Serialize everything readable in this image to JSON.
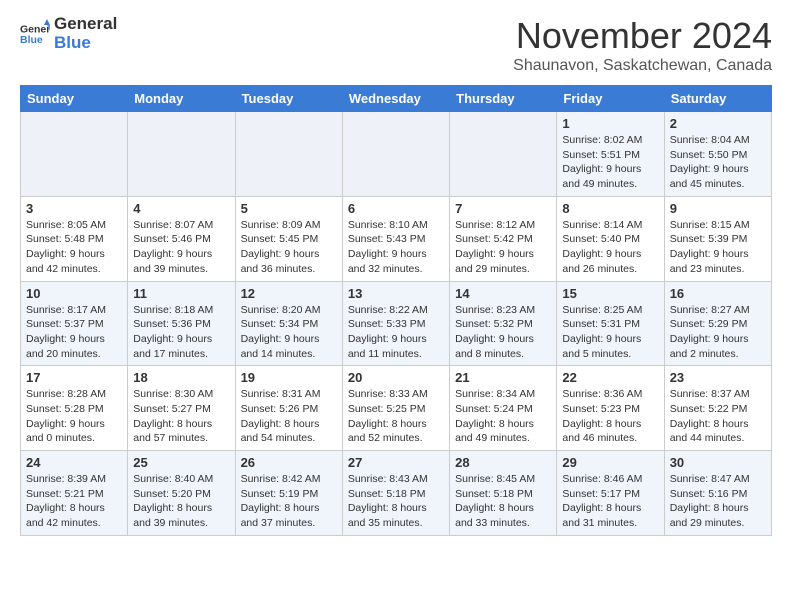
{
  "header": {
    "logo_line1": "General",
    "logo_line2": "Blue",
    "month_title": "November 2024",
    "location": "Shaunavon, Saskatchewan, Canada"
  },
  "weekdays": [
    "Sunday",
    "Monday",
    "Tuesday",
    "Wednesday",
    "Thursday",
    "Friday",
    "Saturday"
  ],
  "weeks": [
    [
      {
        "day": "",
        "info": ""
      },
      {
        "day": "",
        "info": ""
      },
      {
        "day": "",
        "info": ""
      },
      {
        "day": "",
        "info": ""
      },
      {
        "day": "",
        "info": ""
      },
      {
        "day": "1",
        "info": "Sunrise: 8:02 AM\nSunset: 5:51 PM\nDaylight: 9 hours and 49 minutes."
      },
      {
        "day": "2",
        "info": "Sunrise: 8:04 AM\nSunset: 5:50 PM\nDaylight: 9 hours and 45 minutes."
      }
    ],
    [
      {
        "day": "3",
        "info": "Sunrise: 8:05 AM\nSunset: 5:48 PM\nDaylight: 9 hours and 42 minutes."
      },
      {
        "day": "4",
        "info": "Sunrise: 8:07 AM\nSunset: 5:46 PM\nDaylight: 9 hours and 39 minutes."
      },
      {
        "day": "5",
        "info": "Sunrise: 8:09 AM\nSunset: 5:45 PM\nDaylight: 9 hours and 36 minutes."
      },
      {
        "day": "6",
        "info": "Sunrise: 8:10 AM\nSunset: 5:43 PM\nDaylight: 9 hours and 32 minutes."
      },
      {
        "day": "7",
        "info": "Sunrise: 8:12 AM\nSunset: 5:42 PM\nDaylight: 9 hours and 29 minutes."
      },
      {
        "day": "8",
        "info": "Sunrise: 8:14 AM\nSunset: 5:40 PM\nDaylight: 9 hours and 26 minutes."
      },
      {
        "day": "9",
        "info": "Sunrise: 8:15 AM\nSunset: 5:39 PM\nDaylight: 9 hours and 23 minutes."
      }
    ],
    [
      {
        "day": "10",
        "info": "Sunrise: 8:17 AM\nSunset: 5:37 PM\nDaylight: 9 hours and 20 minutes."
      },
      {
        "day": "11",
        "info": "Sunrise: 8:18 AM\nSunset: 5:36 PM\nDaylight: 9 hours and 17 minutes."
      },
      {
        "day": "12",
        "info": "Sunrise: 8:20 AM\nSunset: 5:34 PM\nDaylight: 9 hours and 14 minutes."
      },
      {
        "day": "13",
        "info": "Sunrise: 8:22 AM\nSunset: 5:33 PM\nDaylight: 9 hours and 11 minutes."
      },
      {
        "day": "14",
        "info": "Sunrise: 8:23 AM\nSunset: 5:32 PM\nDaylight: 9 hours and 8 minutes."
      },
      {
        "day": "15",
        "info": "Sunrise: 8:25 AM\nSunset: 5:31 PM\nDaylight: 9 hours and 5 minutes."
      },
      {
        "day": "16",
        "info": "Sunrise: 8:27 AM\nSunset: 5:29 PM\nDaylight: 9 hours and 2 minutes."
      }
    ],
    [
      {
        "day": "17",
        "info": "Sunrise: 8:28 AM\nSunset: 5:28 PM\nDaylight: 9 hours and 0 minutes."
      },
      {
        "day": "18",
        "info": "Sunrise: 8:30 AM\nSunset: 5:27 PM\nDaylight: 8 hours and 57 minutes."
      },
      {
        "day": "19",
        "info": "Sunrise: 8:31 AM\nSunset: 5:26 PM\nDaylight: 8 hours and 54 minutes."
      },
      {
        "day": "20",
        "info": "Sunrise: 8:33 AM\nSunset: 5:25 PM\nDaylight: 8 hours and 52 minutes."
      },
      {
        "day": "21",
        "info": "Sunrise: 8:34 AM\nSunset: 5:24 PM\nDaylight: 8 hours and 49 minutes."
      },
      {
        "day": "22",
        "info": "Sunrise: 8:36 AM\nSunset: 5:23 PM\nDaylight: 8 hours and 46 minutes."
      },
      {
        "day": "23",
        "info": "Sunrise: 8:37 AM\nSunset: 5:22 PM\nDaylight: 8 hours and 44 minutes."
      }
    ],
    [
      {
        "day": "24",
        "info": "Sunrise: 8:39 AM\nSunset: 5:21 PM\nDaylight: 8 hours and 42 minutes."
      },
      {
        "day": "25",
        "info": "Sunrise: 8:40 AM\nSunset: 5:20 PM\nDaylight: 8 hours and 39 minutes."
      },
      {
        "day": "26",
        "info": "Sunrise: 8:42 AM\nSunset: 5:19 PM\nDaylight: 8 hours and 37 minutes."
      },
      {
        "day": "27",
        "info": "Sunrise: 8:43 AM\nSunset: 5:18 PM\nDaylight: 8 hours and 35 minutes."
      },
      {
        "day": "28",
        "info": "Sunrise: 8:45 AM\nSunset: 5:18 PM\nDaylight: 8 hours and 33 minutes."
      },
      {
        "day": "29",
        "info": "Sunrise: 8:46 AM\nSunset: 5:17 PM\nDaylight: 8 hours and 31 minutes."
      },
      {
        "day": "30",
        "info": "Sunrise: 8:47 AM\nSunset: 5:16 PM\nDaylight: 8 hours and 29 minutes."
      }
    ]
  ]
}
